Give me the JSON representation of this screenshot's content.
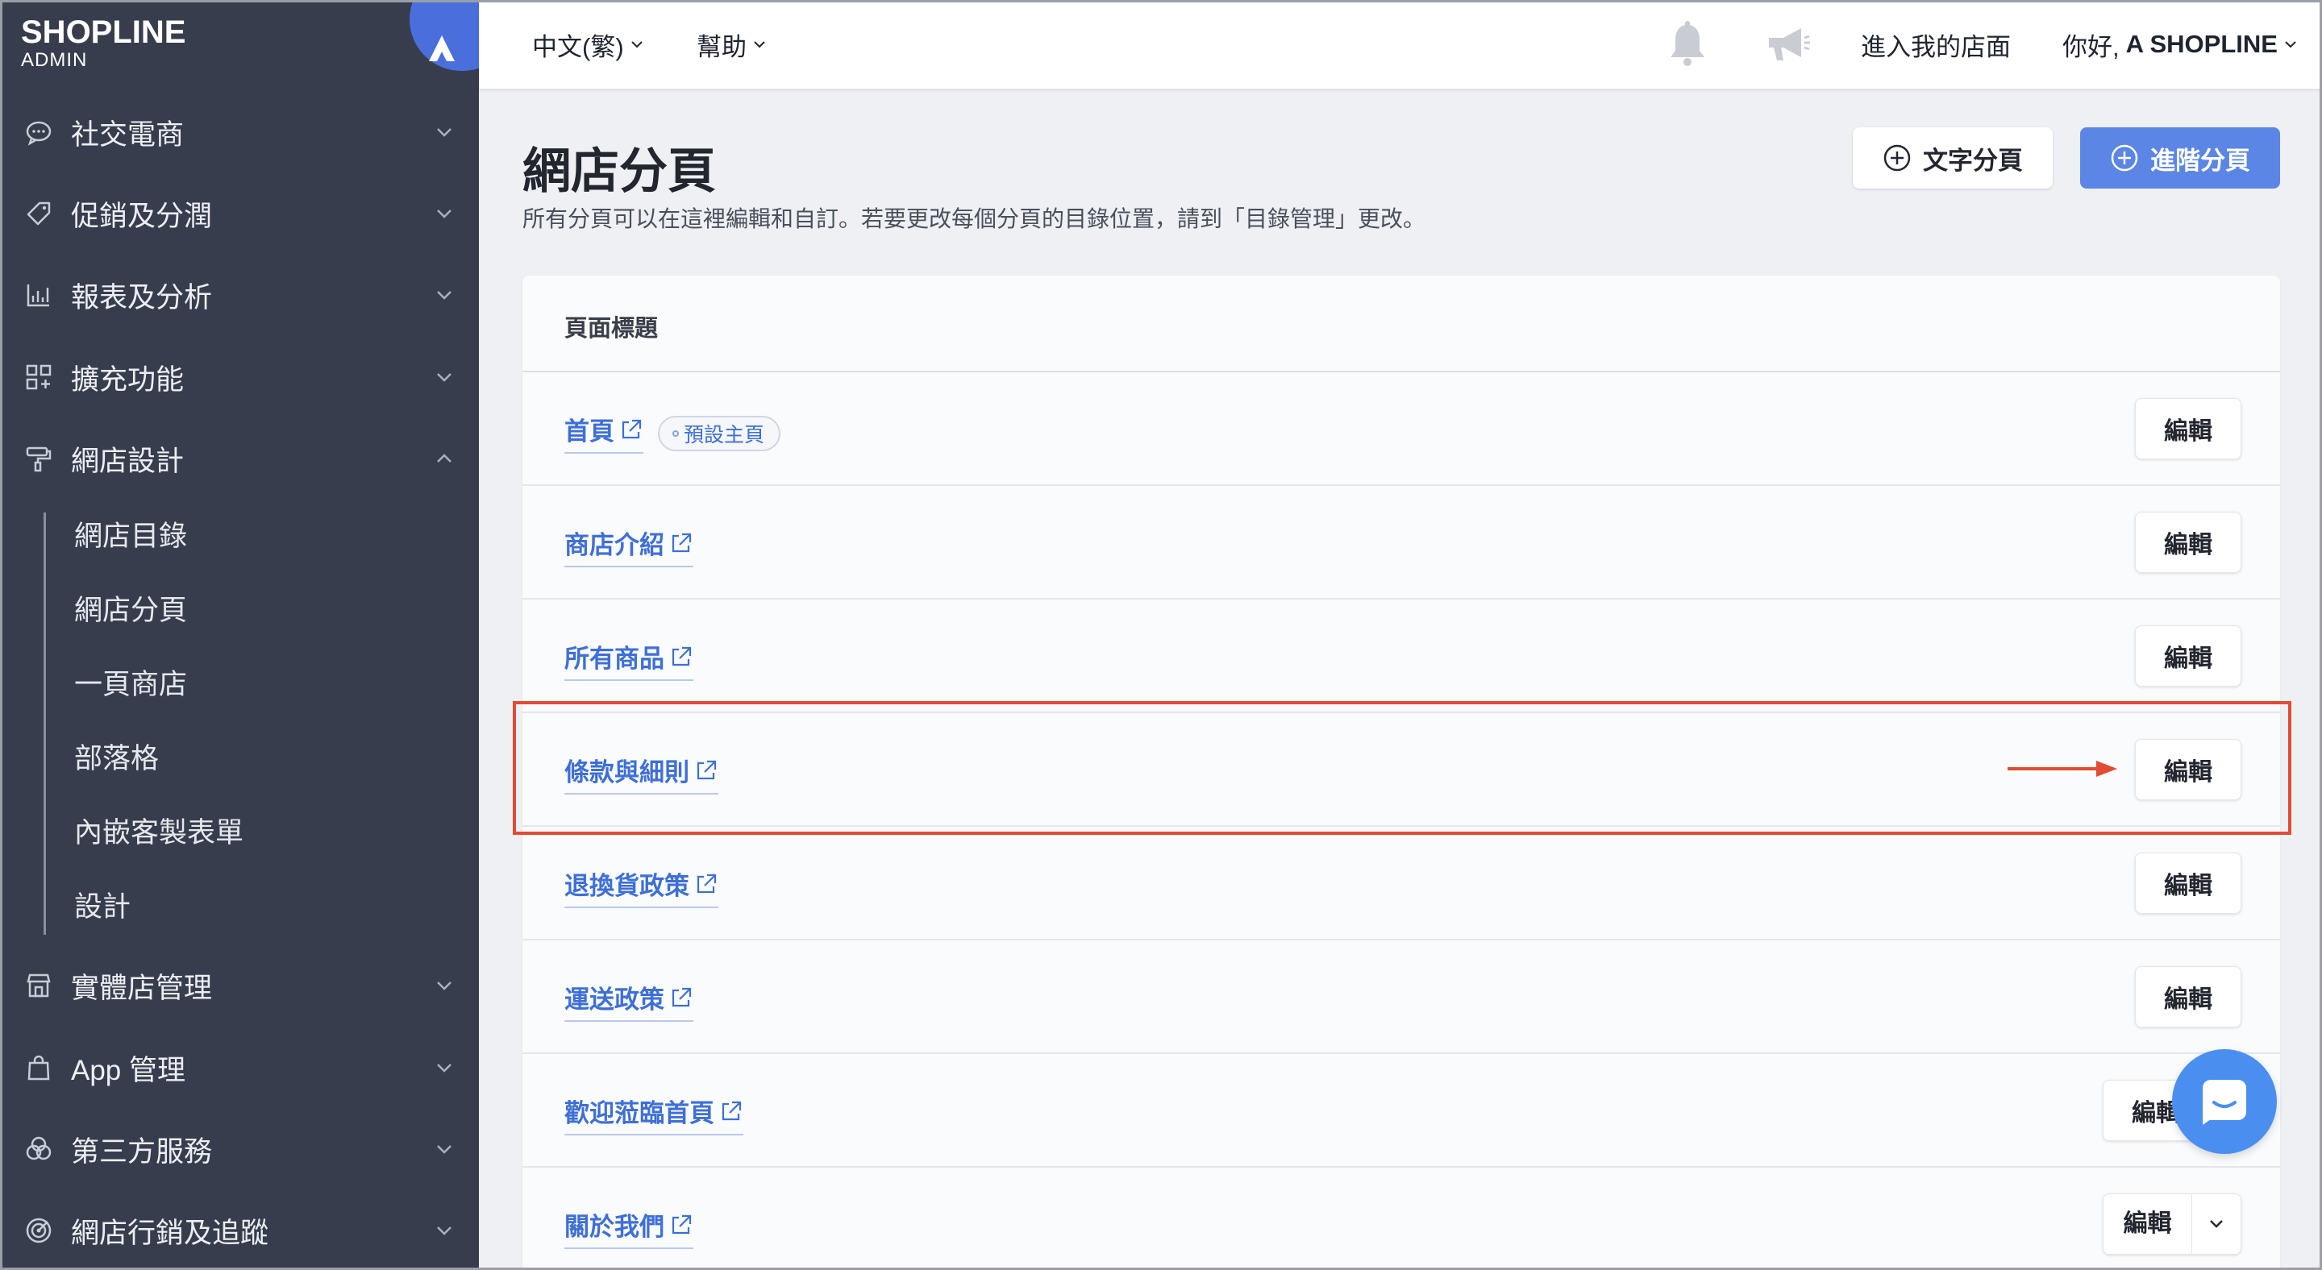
{
  "brand": {
    "name": "SHOPLINE",
    "sub": "ADMIN"
  },
  "sidebar": {
    "items": [
      {
        "label": "社交電商",
        "icon": "chat-bubble-icon"
      },
      {
        "label": "促銷及分潤",
        "icon": "tag-icon"
      },
      {
        "label": "報表及分析",
        "icon": "chart-icon"
      },
      {
        "label": "擴充功能",
        "icon": "grid-plus-icon"
      },
      {
        "label": "網店設計",
        "icon": "paint-roller-icon"
      },
      {
        "label": "實體店管理",
        "icon": "store-icon"
      },
      {
        "label": "App 管理",
        "icon": "shopping-bag-icon"
      },
      {
        "label": "第三方服務",
        "icon": "circles-icon"
      },
      {
        "label": "網店行銷及追蹤",
        "icon": "target-icon"
      }
    ],
    "subitems": [
      "網店目錄",
      "網店分頁",
      "一頁商店",
      "部落格",
      "內嵌客製表單",
      "設計"
    ]
  },
  "header": {
    "language": "中文(繁)",
    "help": "幫助",
    "visit_store": "進入我的店面",
    "greeting_prefix": "你好,",
    "greeting_name": "A SHOPLINE"
  },
  "page": {
    "title": "網店分頁",
    "description": "所有分頁可以在這裡編輯和自訂。若要更改每個分頁的目錄位置，請到「目錄管理」更改。",
    "btn_text_page": "文字分頁",
    "btn_advanced_page": "進階分頁",
    "column_header": "頁面標題",
    "edit_label": "編輯",
    "default_badge": "預設主頁"
  },
  "rows": [
    {
      "title": "首頁"
    },
    {
      "title": "商店介紹"
    },
    {
      "title": "所有商品"
    },
    {
      "title": "條款與細則"
    },
    {
      "title": "退換貨政策"
    },
    {
      "title": "運送政策"
    },
    {
      "title": "歡迎蒞臨首頁"
    },
    {
      "title": "關於我們"
    }
  ],
  "colors": {
    "accent": "#5b86e5",
    "link": "#3e6fd8",
    "sidebar": "#373d4d",
    "highlight": "#e24b34"
  }
}
